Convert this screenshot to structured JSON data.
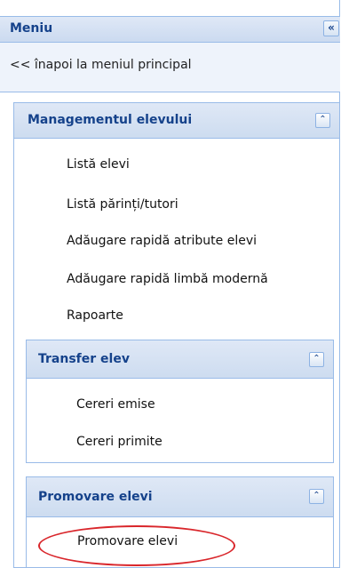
{
  "menu": {
    "title": "Meniu",
    "collapse_glyph": "«",
    "back_link": "<< înapoi la meniul principal"
  },
  "groups": {
    "management": {
      "title": "Managementul elevului",
      "toggle_glyph": "⌃",
      "items": [
        "Listă elevi",
        "Listă părinți/tutori",
        "Adăugare rapidă atribute elevi",
        "Adăugare rapidă limbă modernă",
        "Rapoarte"
      ]
    },
    "transfer": {
      "title": "Transfer elev",
      "toggle_glyph": "⌃",
      "items": [
        "Cereri emise",
        "Cereri primite"
      ]
    },
    "promovare": {
      "title": "Promovare elevi",
      "toggle_glyph": "⌃",
      "items": [
        "Promovare elevi"
      ]
    }
  },
  "annotation": {
    "color": "#d9262b"
  }
}
